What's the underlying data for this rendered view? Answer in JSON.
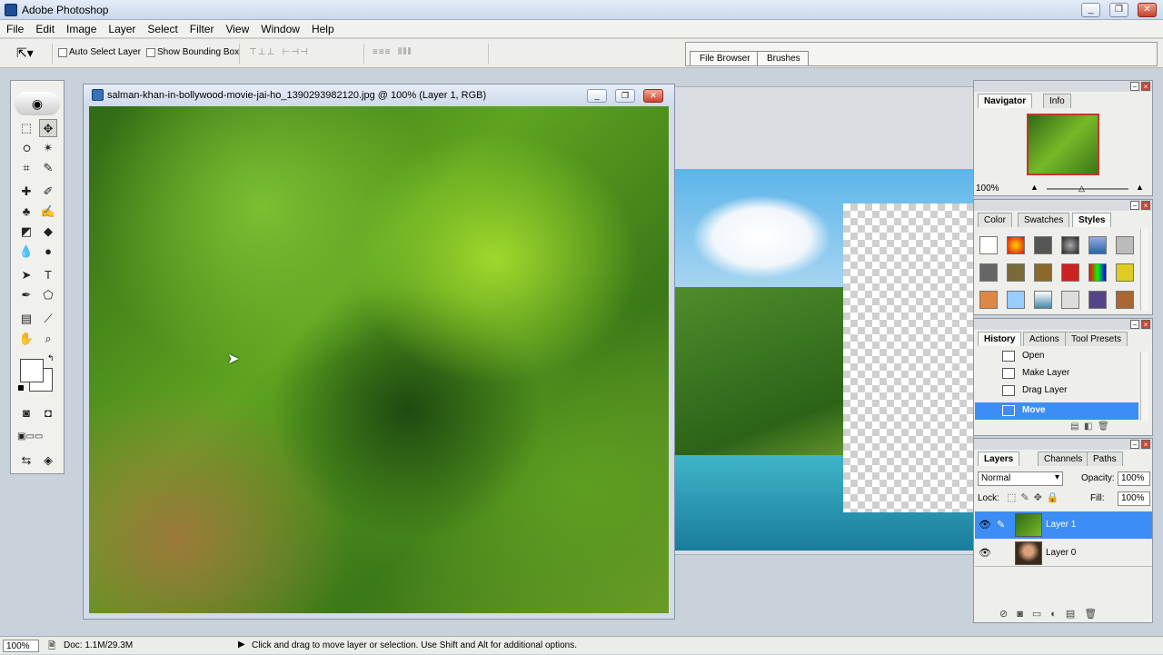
{
  "app": {
    "title": "Adobe Photoshop"
  },
  "window_buttons": {
    "min": "_",
    "restore": "❐",
    "close": "✕"
  },
  "menu": [
    "File",
    "Edit",
    "Image",
    "Layer",
    "Select",
    "Filter",
    "View",
    "Window",
    "Help"
  ],
  "options": {
    "auto_select": "Auto Select Layer",
    "bounding_box": "Show Bounding Box",
    "file_browser": "File Browser",
    "brushes": "Brushes"
  },
  "document": {
    "title": "salman-khan-in-bollywood-movie-jai-ho_1390293982120.jpg @ 100% (Layer 1, RGB)"
  },
  "navigator": {
    "tabs": [
      "Navigator",
      "Info"
    ],
    "zoom": "100%"
  },
  "color_panel": {
    "tabs": [
      "Color",
      "Swatches",
      "Styles"
    ]
  },
  "history": {
    "tabs": [
      "History",
      "Actions",
      "Tool Presets"
    ],
    "items": [
      "Open",
      "Make Layer",
      "Drag Layer",
      "Move"
    ],
    "selected": 3
  },
  "layers": {
    "tabs": [
      "Layers",
      "Channels",
      "Paths"
    ],
    "blend_mode": "Normal",
    "opacity_label": "Opacity:",
    "opacity": "100%",
    "lock_label": "Lock:",
    "fill_label": "Fill:",
    "fill": "100%",
    "items": [
      "Layer 1",
      "Layer 0"
    ],
    "selected": 0
  },
  "status": {
    "zoom": "100%",
    "doc": "Doc: 1.1M/29.3M",
    "hint": "Click and drag to move layer or selection. Use Shift and Alt for additional options."
  },
  "colors": {
    "accent": "#3c8ef6",
    "foliage": "#5ea420",
    "water": "#3fb5c9"
  }
}
